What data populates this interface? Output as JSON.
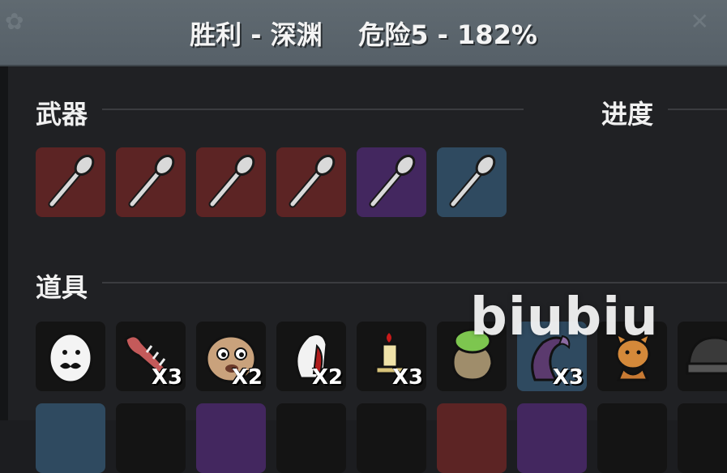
{
  "header": {
    "title": "胜利 - 深渊    危险5 - 182%",
    "left_icon": "clover-icon",
    "right_icon": "bone-icon"
  },
  "weapons": {
    "title": "武器",
    "items": [
      {
        "icon": "spoon-icon",
        "tier": "red"
      },
      {
        "icon": "spoon-icon",
        "tier": "red"
      },
      {
        "icon": "spoon-icon",
        "tier": "red"
      },
      {
        "icon": "spoon-icon",
        "tier": "red"
      },
      {
        "icon": "spoon-icon",
        "tier": "purple"
      },
      {
        "icon": "spoon-icon",
        "tier": "blue"
      }
    ]
  },
  "progress": {
    "title": "进度"
  },
  "items": {
    "title": "道具",
    "row1": [
      {
        "icon": "mustache-egg-icon",
        "count": ""
      },
      {
        "icon": "fish-bones-icon",
        "count": "X3"
      },
      {
        "icon": "potato-face-icon",
        "count": "X2"
      },
      {
        "icon": "tooth-shell-icon",
        "count": "X2"
      },
      {
        "icon": "candle-icon",
        "count": "X3"
      },
      {
        "icon": "seed-bag-icon",
        "count": ""
      },
      {
        "icon": "tentacle-icon",
        "count": "X3"
      },
      {
        "icon": "cat-plush-icon",
        "count": ""
      },
      {
        "icon": "beanie-hat-icon",
        "count": ""
      }
    ]
  },
  "watermark": "biubiu",
  "colors": {
    "tier_red": "#5c2424",
    "tier_purple": "#43275f",
    "tier_blue": "#2f4a60",
    "slot_dark": "#141414"
  }
}
